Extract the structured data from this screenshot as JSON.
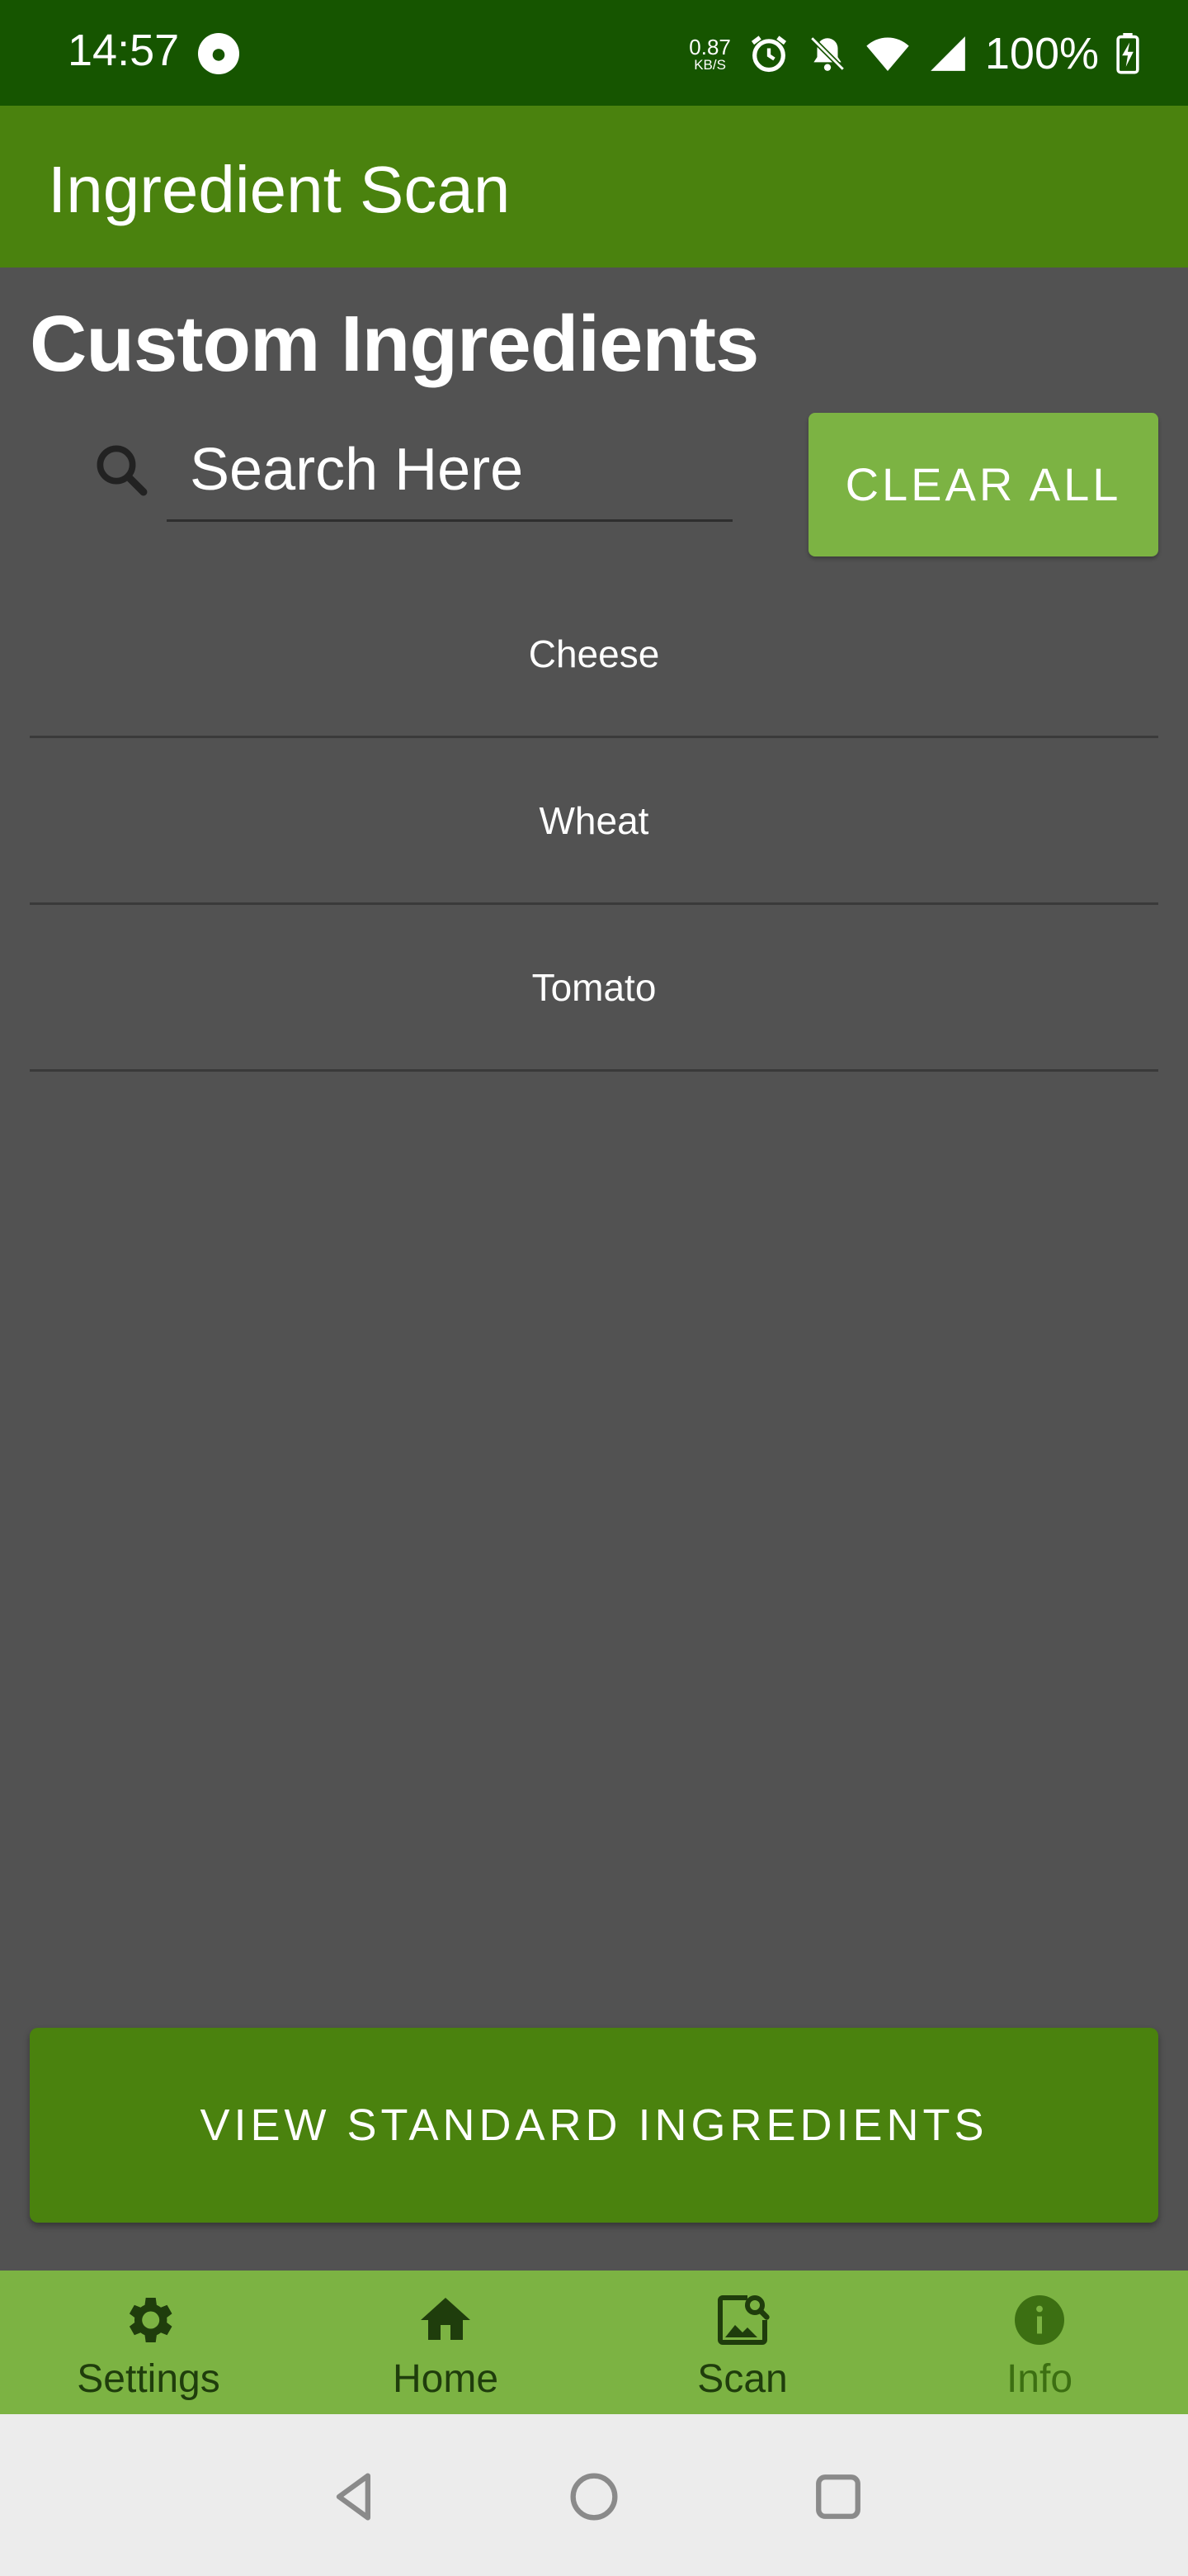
{
  "status_bar": {
    "time": "14:57",
    "net_speed_value": "0.87",
    "net_speed_unit": "KB/S",
    "battery": "100%",
    "icons": [
      "app-notification-icon",
      "alarm-icon",
      "notifications-off-icon",
      "wifi-icon",
      "cell-signal-icon",
      "battery-charging-icon"
    ]
  },
  "app_bar": {
    "title": "Ingredient Scan"
  },
  "main": {
    "page_title": "Custom Ingredients",
    "search": {
      "placeholder": "Search Here",
      "value": ""
    },
    "clear_all_label": "CLEAR ALL",
    "ingredients": [
      "Cheese",
      "Wheat",
      "Tomato"
    ],
    "view_standard_label": "VIEW STANDARD INGREDIENTS"
  },
  "bottom_nav": {
    "items": [
      {
        "label": "Settings",
        "icon": "gear-icon"
      },
      {
        "label": "Home",
        "icon": "home-icon"
      },
      {
        "label": "Scan",
        "icon": "image-search-icon"
      },
      {
        "label": "Info",
        "icon": "info-icon"
      }
    ]
  },
  "colors": {
    "status_bar": "#165500",
    "app_bar": "#4a820e",
    "background": "#525252",
    "accent_light": "#7cb343",
    "system_nav": "#ececec"
  }
}
